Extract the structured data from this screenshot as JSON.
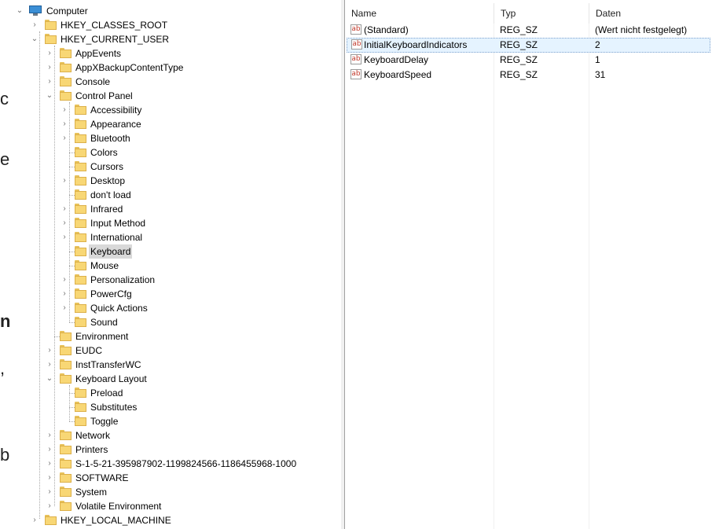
{
  "background_fragments": [
    "c",
    "ei",
    "n",
    ",",
    "be"
  ],
  "tree": {
    "root": "Computer",
    "hkcr": "HKEY_CLASSES_ROOT",
    "hkcu": "HKEY_CURRENT_USER",
    "hkcu_children": [
      "AppEvents",
      "AppXBackupContentType",
      "Console",
      "Control Panel"
    ],
    "control_panel_children": [
      "Accessibility",
      "Appearance",
      "Bluetooth",
      "Colors",
      "Cursors",
      "Desktop",
      "don't load",
      "Infrared",
      "Input Method",
      "International",
      "Keyboard",
      "Mouse",
      "Personalization",
      "PowerCfg",
      "Quick Actions",
      "Sound"
    ],
    "hkcu_children_after": [
      "Environment",
      "EUDC",
      "InstTransferWC",
      "Keyboard Layout"
    ],
    "keyboard_layout_children": [
      "Preload",
      "Substitutes",
      "Toggle"
    ],
    "hkcu_children_tail": [
      "Network",
      "Printers",
      "S-1-5-21-395987902-1199824566-1186455968-1000",
      "SOFTWARE",
      "System",
      "Volatile Environment"
    ],
    "hklm": "HKEY_LOCAL_MACHINE",
    "selected": "Keyboard"
  },
  "list": {
    "columns": [
      "Name",
      "Typ",
      "Daten"
    ],
    "rows": [
      {
        "name": "(Standard)",
        "type": "REG_SZ",
        "data": "(Wert nicht festgelegt)"
      },
      {
        "name": "InitialKeyboardIndicators",
        "type": "REG_SZ",
        "data": "2"
      },
      {
        "name": "KeyboardDelay",
        "type": "REG_SZ",
        "data": "1"
      },
      {
        "name": "KeyboardSpeed",
        "type": "REG_SZ",
        "data": "31"
      }
    ],
    "selected_row": "InitialKeyboardIndicators",
    "icon_glyph": "ab"
  }
}
